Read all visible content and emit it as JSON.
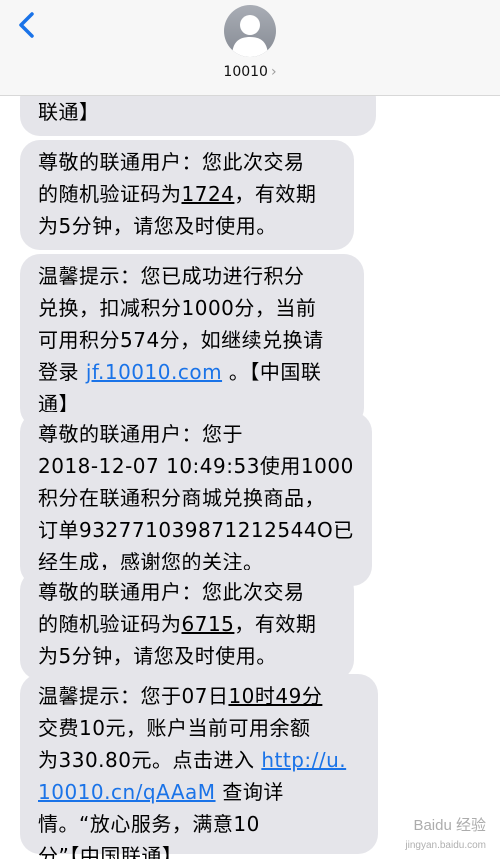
{
  "header": {
    "contact_name": "10010",
    "chevron": "›",
    "back_icon": "chevron-left-icon",
    "avatar_icon": "person-silhouette-icon",
    "accent_color": "#1a73e8"
  },
  "messages": [
    {
      "lines": [
        "联通】"
      ]
    },
    {
      "lines": [
        "尊敬的联通用户：您此次交易",
        "的随机验证码为",
        "1724",
        "，有效期",
        "为5分钟，请您及时使用。"
      ]
    },
    {
      "lines": [
        "温馨提示：您已成功进行积分",
        "兑换，扣减积分1000分，当前",
        "可用积分574分，如继续兑换请",
        "登录 ",
        "jf.10010.com",
        " 。【中国联",
        "通】"
      ]
    },
    {
      "lines": [
        "尊敬的联通用户：您于",
        "2018-12-07 10:49:53使用1000",
        "积分在联通积分商城兑换商品，",
        "订单932771039871212544O已",
        "经生成，感谢您的关注。"
      ]
    },
    {
      "lines": [
        "尊敬的联通用户：您此次交易",
        "的随机验证码为",
        "6715",
        "，有效期",
        "为5分钟，请您及时使用。"
      ]
    },
    {
      "lines": [
        "温馨提示：您于07日",
        "10时49分",
        "交费10元，账户当前可用余额",
        "为330.80元。点击进入 ",
        "http://u.",
        "10010.cn/qAAaM",
        " 查询详",
        "情。“放心服务，满意10",
        "分”【中国联通】"
      ]
    }
  ],
  "watermark": {
    "text": "Baidu 经验",
    "sub": "jingyan.baidu.com"
  }
}
